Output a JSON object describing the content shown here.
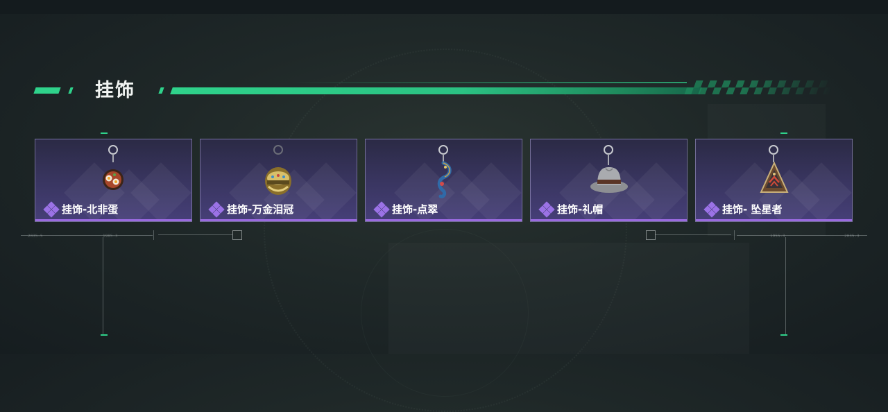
{
  "section": {
    "title": "挂饰"
  },
  "colors": {
    "accent": "#2fd28b",
    "card_bg": "#3a3662",
    "rarity": "#9b72e6"
  },
  "items": [
    {
      "name": "挂饰-北非蛋",
      "icon": "shakshuka-pan-charm-icon"
    },
    {
      "name": "挂饰-万金泪冠",
      "icon": "golden-crown-charm-icon"
    },
    {
      "name": "挂饰-点翠",
      "icon": "kingfisher-ornament-charm-icon"
    },
    {
      "name": "挂饰-礼帽",
      "icon": "fedora-hat-charm-icon"
    },
    {
      "name": "挂饰- 坠星者",
      "icon": "triangle-emblem-charm-icon"
    }
  ],
  "decor": {
    "left_codes": [
      "2035-5",
      "1985-3"
    ],
    "right_codes": [
      "1955-3",
      "2035-3"
    ]
  }
}
